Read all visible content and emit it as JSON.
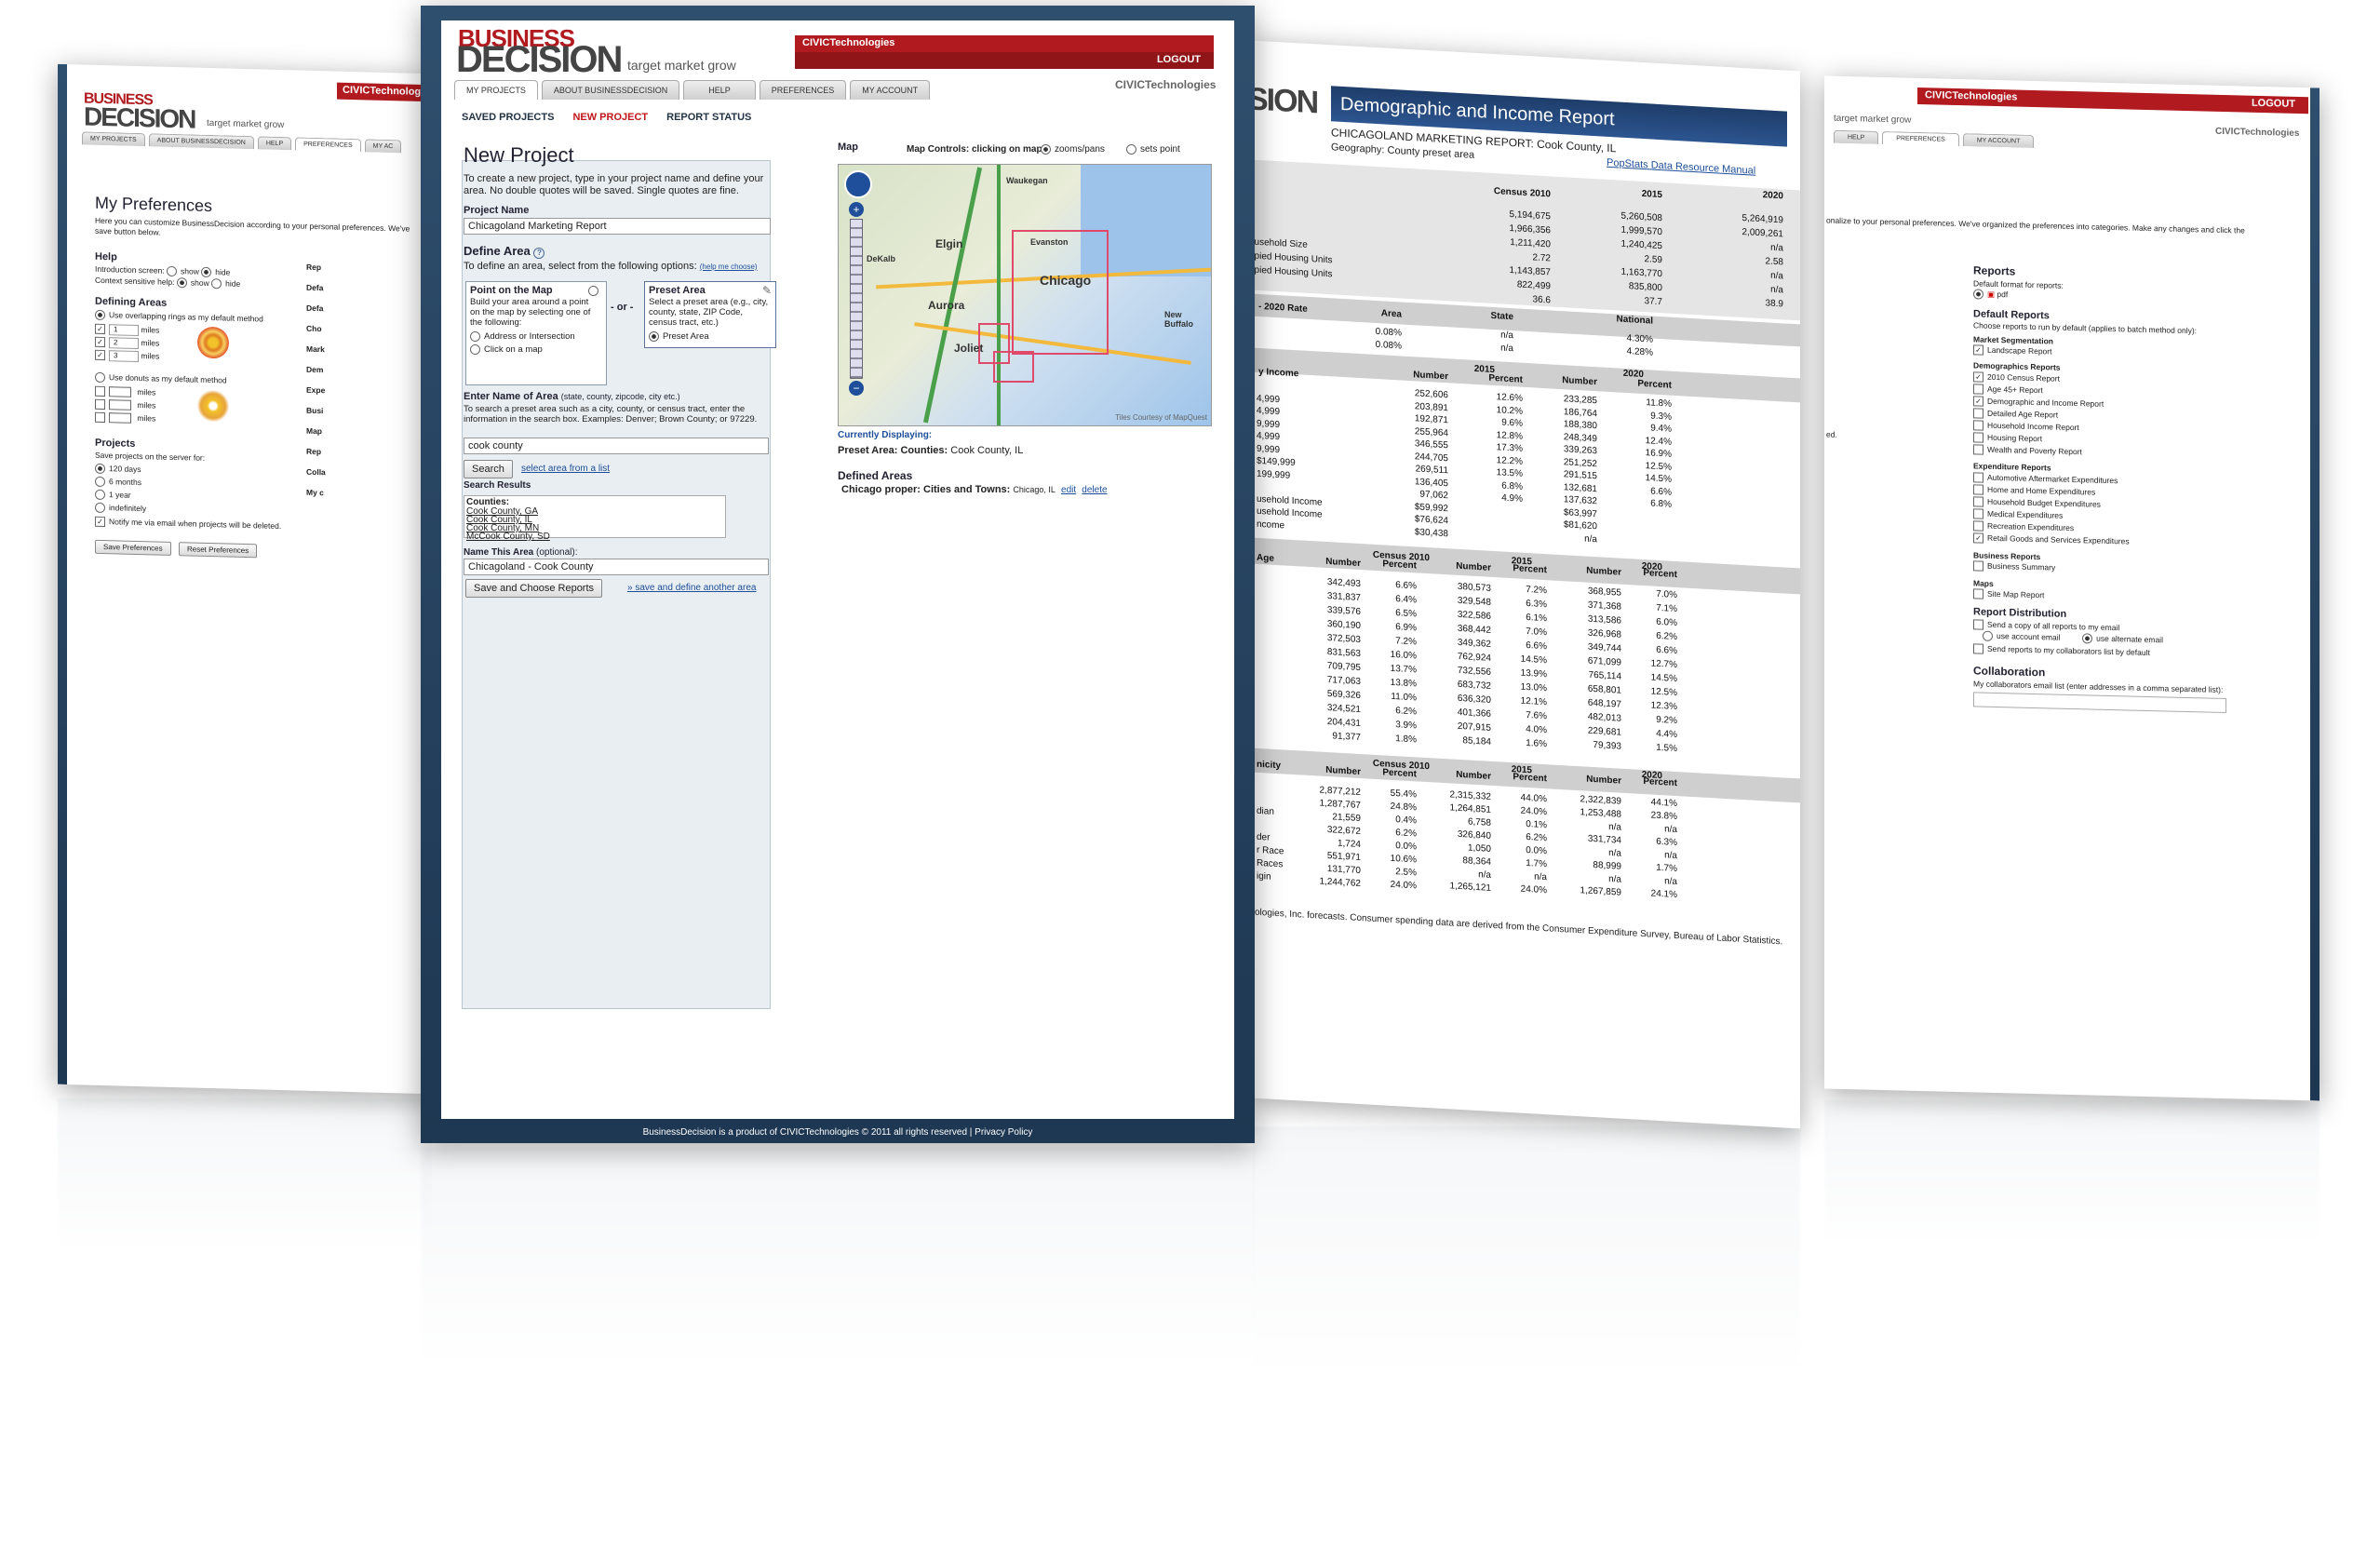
{
  "brand": {
    "logo_top": "BUSINESS",
    "logo_bottom": "DECISION",
    "tagline": "target   market   grow",
    "civic": "CIVICTechnologies",
    "civic_small": "CIVICTechnologies",
    "logout": "LOGOUT"
  },
  "center": {
    "tabs": [
      "MY PROJECTS",
      "ABOUT BUSINESSDECISION",
      "HELP",
      "PREFERENCES",
      "MY ACCOUNT"
    ],
    "subnav": [
      "SAVED PROJECTS",
      "NEW PROJECT",
      "REPORT STATUS"
    ],
    "title": "New Project",
    "intro": "To create a new project, type in your project name and define your area. No double quotes will be saved. Single quotes are fine.",
    "project_name_label": "Project Name",
    "project_name_value": "Chicagoland Marketing Report",
    "define_area_label": "Define Area",
    "define_area_help": "?",
    "define_area_text": "To define an area, select from the following options:",
    "help_me_choose": "(help me choose)",
    "point_title": "Point on the Map",
    "point_text": "Build your area around a point on the map by selecting one of the following:",
    "point_opt1": "Address or Intersection",
    "point_opt2": "Click on a map",
    "or_text": "- or -",
    "preset_title": "Preset Area",
    "preset_text": "Select a preset area (e.g., city, county, state, ZIP Code, census tract, etc.)",
    "preset_opt": "Preset Area",
    "enter_name_label": "Enter Name of Area",
    "enter_name_hint": "(state, county, zipcode, city etc.)",
    "enter_name_text": "To search a preset area such as a city, county, or census tract, enter the information in the search box. Examples: Denver; Brown County; or 97229.",
    "search_value": "cook county",
    "search_button": "Search",
    "select_from_list": "select area from a list",
    "search_results_label": "Search Results",
    "counties_label": "Counties:",
    "results": [
      "Cook County, GA",
      "Cook County, IL",
      "Cook County, MN",
      "McCook County, SD"
    ],
    "name_area_label": "Name This Area",
    "name_area_optional": "(optional):",
    "name_area_value": "Chicagoland - Cook County",
    "save_button": "Save and Choose Reports",
    "save_another": "» save and define another area",
    "map_label": "Map",
    "map_controls_label": "Map Controls:",
    "map_controls_text": "clicking on map",
    "zoom_opt": "zooms/pans",
    "sets_opt": "sets point",
    "map_cities": [
      "Waukegan",
      "Elgin",
      "Evanston",
      "Chicago",
      "Aurora",
      "Joliet",
      "DeKalb",
      "New Buffalo"
    ],
    "map_credit": "Tiles Courtesy of MapQuest",
    "currently_displaying": "Currently Displaying:",
    "preset_area_label": "Preset Area:",
    "counties_small": "Counties:",
    "preset_area_value": "Cook County, IL",
    "defined_areas_label": "Defined Areas",
    "defined_name": "Chicago proper:",
    "defined_type": "Cities and Towns:",
    "defined_value": "Chicago, IL",
    "edit": "edit",
    "delete": "delete",
    "footer": "BusinessDecision is a product of CIVICTechnologies © 2011 all rights reserved | Privacy Policy"
  },
  "left": {
    "tabs": [
      "MY PROJECTS",
      "ABOUT BUSINESSDECISION",
      "HELP",
      "PREFERENCES",
      "MY AC"
    ],
    "title": "My Preferences",
    "intro": "Here you can customize BusinessDecision according to your personal preferences. We've",
    "intro2": "save button below.",
    "help_h": "Help",
    "intro_screen": "Introduction screen:",
    "show": "show",
    "hide": "hide",
    "context_help": "Context sensitive help:",
    "defining_h": "Defining Areas",
    "rings_opt": "Use overlapping rings as my default method",
    "rings": [
      "1",
      "2",
      "3"
    ],
    "miles": "miles",
    "donuts_opt": "Use donuts as my default method",
    "projects_h": "Projects",
    "save_projects": "Save projects on the server for:",
    "durations": [
      "120 days",
      "6 months",
      "1 year",
      "indefinitely"
    ],
    "notify": "Notify me via email when projects will be deleted.",
    "save_prefs": "Save Preferences",
    "reset_prefs": "Reset Preferences",
    "right_frag": [
      "Rep",
      "Defa",
      "Defa",
      "Cho",
      "Mark",
      "Dem",
      "Expe",
      "Busi",
      "Map",
      "Rep",
      "Colla",
      "My c"
    ]
  },
  "report": {
    "logo_frag": "SION",
    "title": "Demographic and Income Report",
    "subtitle": "CHICAGOLAND MARKETING REPORT: Cook County, IL",
    "geography": "Geography: County preset area",
    "popstats": "PopStats Data Resource Manual",
    "summary_headers": [
      "Census 2010",
      "2015",
      "2020"
    ],
    "summary_rows": [
      {
        "label": "",
        "v": [
          "5,194,675",
          "5,260,508",
          "5,264,919"
        ]
      },
      {
        "label": "",
        "v": [
          "1,966,356",
          "1,999,570",
          "2,009,261"
        ]
      },
      {
        "label": "",
        "v": [
          "1,211,420",
          "1,240,425",
          "n/a"
        ]
      },
      {
        "label": "ousehold Size",
        "v": [
          "2.72",
          "2.59",
          "2.58"
        ]
      },
      {
        "label": "upied Housing Units",
        "v": [
          "1,143,857",
          "1,163,770",
          "n/a"
        ]
      },
      {
        "label": "upied Housing Units",
        "v": [
          "822,499",
          "835,800",
          "n/a"
        ]
      },
      {
        "label": "",
        "v": [
          "36.6",
          "37.7",
          "38.9"
        ]
      }
    ],
    "rate_label": "- 2020 Rate",
    "rate_headers": [
      "Area",
      "State",
      "National"
    ],
    "rate_rows": [
      [
        "0.08%",
        "n/a",
        "4.30%"
      ],
      [
        "0.08%",
        "n/a",
        "4.28%"
      ]
    ],
    "income_label": "y Income",
    "income_headers": [
      "2015",
      "2020"
    ],
    "income_sub": [
      "Number",
      "Percent",
      "Number",
      "Percent"
    ],
    "income_rows": [
      {
        "label": "",
        "v": [
          "252,606",
          "12.6%",
          "233,285",
          "11.8%"
        ]
      },
      {
        "label": "4,999",
        "v": [
          "203,891",
          "10.2%",
          "186,764",
          "9.3%"
        ]
      },
      {
        "label": "4,999",
        "v": [
          "192,871",
          "9.6%",
          "188,380",
          "9.4%"
        ]
      },
      {
        "label": "9,999",
        "v": [
          "255,964",
          "12.8%",
          "248,349",
          "12.4%"
        ]
      },
      {
        "label": "4,999",
        "v": [
          "346,555",
          "17.3%",
          "339,263",
          "16.9%"
        ]
      },
      {
        "label": "9,999",
        "v": [
          "244,705",
          "12.2%",
          "251,252",
          "12.5%"
        ]
      },
      {
        "label": "$149,999",
        "v": [
          "269,511",
          "13.5%",
          "291,515",
          "14.5%"
        ]
      },
      {
        "label": "199,999",
        "v": [
          "136,405",
          "6.8%",
          "132,681",
          "6.6%"
        ]
      },
      {
        "label": "",
        "v": [
          "97,062",
          "4.9%",
          "137,632",
          "6.8%"
        ]
      }
    ],
    "income_summary": [
      {
        "label": "usehold Income",
        "v": [
          "$59,992",
          "$63,997"
        ]
      },
      {
        "label": "usehold Income",
        "v": [
          "$76,624",
          "$81,620"
        ]
      },
      {
        "label": "ncome",
        "v": [
          "$30,438",
          "n/a"
        ]
      }
    ],
    "age_label": "Age",
    "age_headers": [
      "Census 2010",
      "2015",
      "2020"
    ],
    "age_sub": [
      "Number",
      "Percent",
      "Number",
      "Percent",
      "Number",
      "Percent"
    ],
    "age_rows": [
      [
        "342,493",
        "6.6%",
        "380,573",
        "7.2%",
        "368,955",
        "7.0%"
      ],
      [
        "331,837",
        "6.4%",
        "329,548",
        "6.3%",
        "371,368",
        "7.1%"
      ],
      [
        "339,576",
        "6.5%",
        "322,586",
        "6.1%",
        "313,586",
        "6.0%"
      ],
      [
        "360,190",
        "6.9%",
        "368,442",
        "7.0%",
        "326,968",
        "6.2%"
      ],
      [
        "372,503",
        "7.2%",
        "349,362",
        "6.6%",
        "349,744",
        "6.6%"
      ],
      [
        "831,563",
        "16.0%",
        "762,924",
        "14.5%",
        "671,099",
        "12.7%"
      ],
      [
        "709,795",
        "13.7%",
        "732,556",
        "13.9%",
        "765,114",
        "14.5%"
      ],
      [
        "717,063",
        "13.8%",
        "683,732",
        "13.0%",
        "658,801",
        "12.5%"
      ],
      [
        "569,326",
        "11.0%",
        "636,320",
        "12.1%",
        "648,197",
        "12.3%"
      ],
      [
        "324,521",
        "6.2%",
        "401,366",
        "7.6%",
        "482,013",
        "9.2%"
      ],
      [
        "204,431",
        "3.9%",
        "207,915",
        "4.0%",
        "229,681",
        "4.4%"
      ],
      [
        "91,377",
        "1.8%",
        "85,184",
        "1.6%",
        "79,393",
        "1.5%"
      ]
    ],
    "eth_label": "nicity",
    "eth_headers": [
      "Census 2010",
      "2015",
      "2020"
    ],
    "eth_sub": [
      "Number",
      "Percent",
      "Number",
      "Percent",
      "Number",
      "Percent"
    ],
    "eth_rows": [
      {
        "label": "",
        "v": [
          "2,877,212",
          "55.4%",
          "2,315,332",
          "44.0%",
          "2,322,839",
          "44.1%"
        ]
      },
      {
        "label": "",
        "v": [
          "1,287,767",
          "24.8%",
          "1,264,851",
          "24.0%",
          "1,253,488",
          "23.8%"
        ]
      },
      {
        "label": "dian",
        "v": [
          "21,559",
          "0.4%",
          "6,758",
          "0.1%",
          "n/a",
          "n/a"
        ]
      },
      {
        "label": "",
        "v": [
          "322,672",
          "6.2%",
          "326,840",
          "6.2%",
          "331,734",
          "6.3%"
        ]
      },
      {
        "label": "der",
        "v": [
          "1,724",
          "0.0%",
          "1,050",
          "0.0%",
          "n/a",
          "n/a"
        ]
      },
      {
        "label": "r Race",
        "v": [
          "551,971",
          "10.6%",
          "88,364",
          "1.7%",
          "88,999",
          "1.7%"
        ]
      },
      {
        "label": "Races",
        "v": [
          "131,770",
          "2.5%",
          "n/a",
          "n/a",
          "n/a",
          "n/a"
        ]
      },
      {
        "label": "igin",
        "v": [
          "1,244,762",
          "24.0%",
          "1,265,121",
          "24.0%",
          "1,267,859",
          "24.1%"
        ]
      }
    ],
    "footnote": "ologies, Inc. forecasts. Consumer spending data are derived from the Consumer Expenditure Survey, Bureau of Labor Statistics."
  },
  "right": {
    "tabs": [
      "HELP",
      "PREFERENCES",
      "MY ACCOUNT"
    ],
    "intro": "onalize to your personal preferences. We've organized the preferences into categories. Make any changes and click the",
    "reports_h": "Reports",
    "default_format": "Default format for reports:",
    "pdf": "pdf",
    "default_reports_h": "Default Reports",
    "default_reports_text": "Choose reports to run by default (applies to batch method only):",
    "market_seg_h": "Market Segmentation",
    "landscape": "Landscape Report",
    "demo_h": "Demographics Reports",
    "demo_items": [
      "2010 Census Report",
      "Age 45+ Report",
      "Demographic and Income Report",
      "Detailed Age Report",
      "Household Income Report",
      "Housing Report",
      "Wealth and Poverty Report"
    ],
    "exp_h": "Expenditure Reports",
    "exp_items": [
      "Automotive Aftermarket Expenditures",
      "Home and Home Expenditures",
      "Household Budget Expenditures",
      "Medical Expenditures",
      "Recreation Expenditures",
      "Retail Goods and Services Expenditures"
    ],
    "biz_h": "Business Reports",
    "biz_items": [
      "Business Summary"
    ],
    "maps_h": "Maps",
    "maps_items": [
      "Site Map Report"
    ],
    "dist_h": "Report Distribution",
    "dist_copy": "Send a copy of all reports to my email",
    "use_account": "use account email",
    "use_alt": "use alternate email",
    "dist_collab": "Send reports to my collaborators list by default",
    "collab_h": "Collaboration",
    "collab_text": "My collaborators email list (enter addresses in a comma separated list):",
    "frag_ed": "ed."
  }
}
